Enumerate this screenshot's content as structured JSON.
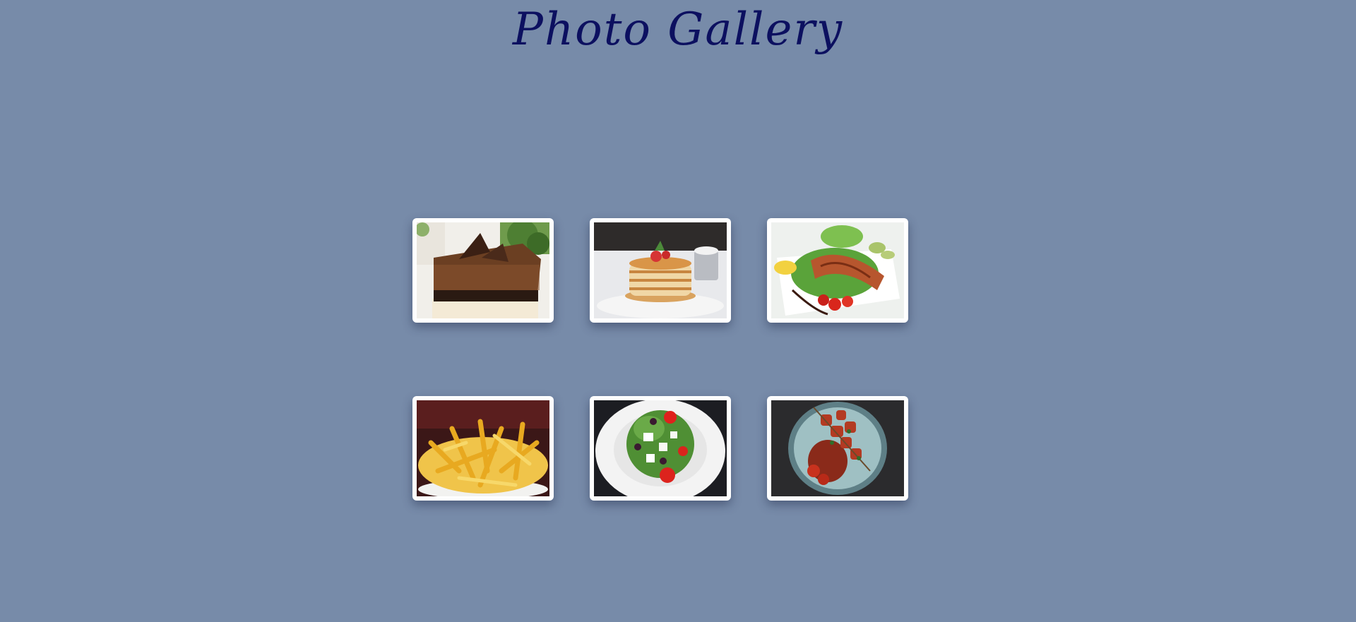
{
  "page": {
    "title": "Photo Gallery"
  },
  "colors": {
    "background": "#778ba9",
    "title": "#0c1060",
    "card_frame": "#ffffff"
  },
  "gallery": {
    "photos": [
      {
        "subject": "chocolate-cake-slice"
      },
      {
        "subject": "pancake-stack"
      },
      {
        "subject": "grilled-salmon-salad"
      },
      {
        "subject": "french-fries"
      },
      {
        "subject": "greek-salad"
      },
      {
        "subject": "meat-skewers"
      }
    ]
  }
}
